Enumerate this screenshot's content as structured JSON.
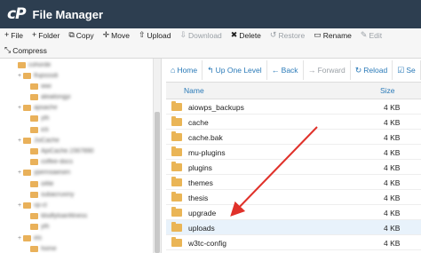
{
  "app": {
    "logo": "cP",
    "title": "File Manager"
  },
  "toolbar": [
    {
      "icon": "+",
      "label": "File",
      "name": "new-file-button",
      "disabled": false
    },
    {
      "icon": "+",
      "label": "Folder",
      "name": "new-folder-button",
      "disabled": false
    },
    {
      "icon": "⧉",
      "label": "Copy",
      "name": "copy-button",
      "disabled": false
    },
    {
      "icon": "✛",
      "label": "Move",
      "name": "move-button",
      "disabled": false
    },
    {
      "icon": "⇧",
      "label": "Upload",
      "name": "upload-button",
      "disabled": false
    },
    {
      "icon": "⇩",
      "label": "Download",
      "name": "download-button",
      "disabled": true
    },
    {
      "icon": "✖",
      "label": "Delete",
      "name": "delete-button",
      "disabled": false
    },
    {
      "icon": "↺",
      "label": "Restore",
      "name": "restore-button",
      "disabled": true
    },
    {
      "icon": "▭",
      "label": "Rename",
      "name": "rename-button",
      "disabled": false
    },
    {
      "icon": "✎",
      "label": "Edit",
      "name": "edit-button",
      "disabled": true
    }
  ],
  "toolbar_row2": [
    {
      "icon": "⤡",
      "label": "Compress",
      "name": "compress-button",
      "disabled": false
    }
  ],
  "nav": [
    {
      "icon": "⌂",
      "label": "Home",
      "name": "home-button",
      "disabled": false
    },
    {
      "icon": "↰",
      "label": "Up One Level",
      "name": "up-one-level-button",
      "disabled": false
    },
    {
      "icon": "←",
      "label": "Back",
      "name": "back-button",
      "disabled": false
    },
    {
      "icon": "→",
      "label": "Forward",
      "name": "forward-button",
      "disabled": true
    },
    {
      "icon": "↻",
      "label": "Reload",
      "name": "reload-button",
      "disabled": false
    },
    {
      "icon": "☑",
      "label": "Se",
      "name": "select-all-button",
      "disabled": false
    }
  ],
  "tree": {
    "first_label": "cohorde",
    "items": [
      "lfupsssdi",
      "wwi",
      "aleaitongyi",
      "apsache",
      "yth",
      "icti",
      "JsiCache",
      "ApiCache.1567890",
      "coffee-docs",
      "ypemsiaesen",
      "oifile",
      "subacruxiny",
      "vp-cl",
      "ldsdfytoanfitness",
      "yth",
      "etc",
      "home"
    ]
  },
  "list": {
    "headers": {
      "name": "Name",
      "size": "Size"
    },
    "rows": [
      {
        "name": "aiowps_backups",
        "size": "4 KB",
        "selected": false
      },
      {
        "name": "cache",
        "size": "4 KB",
        "selected": false
      },
      {
        "name": "cache.bak",
        "size": "4 KB",
        "selected": false
      },
      {
        "name": "mu-plugins",
        "size": "4 KB",
        "selected": false
      },
      {
        "name": "plugins",
        "size": "4 KB",
        "selected": false
      },
      {
        "name": "themes",
        "size": "4 KB",
        "selected": false
      },
      {
        "name": "thesis",
        "size": "4 KB",
        "selected": false
      },
      {
        "name": "upgrade",
        "size": "4 KB",
        "selected": false
      },
      {
        "name": "uploads",
        "size": "4 KB",
        "selected": true
      },
      {
        "name": "w3tc-config",
        "size": "4 KB",
        "selected": false
      }
    ]
  },
  "colors": {
    "titlebar": "#2d3e50",
    "link": "#2a7ab8",
    "folder": "#eab556",
    "arrow": "#e0312a",
    "selected_row": "#e8f2fb"
  }
}
